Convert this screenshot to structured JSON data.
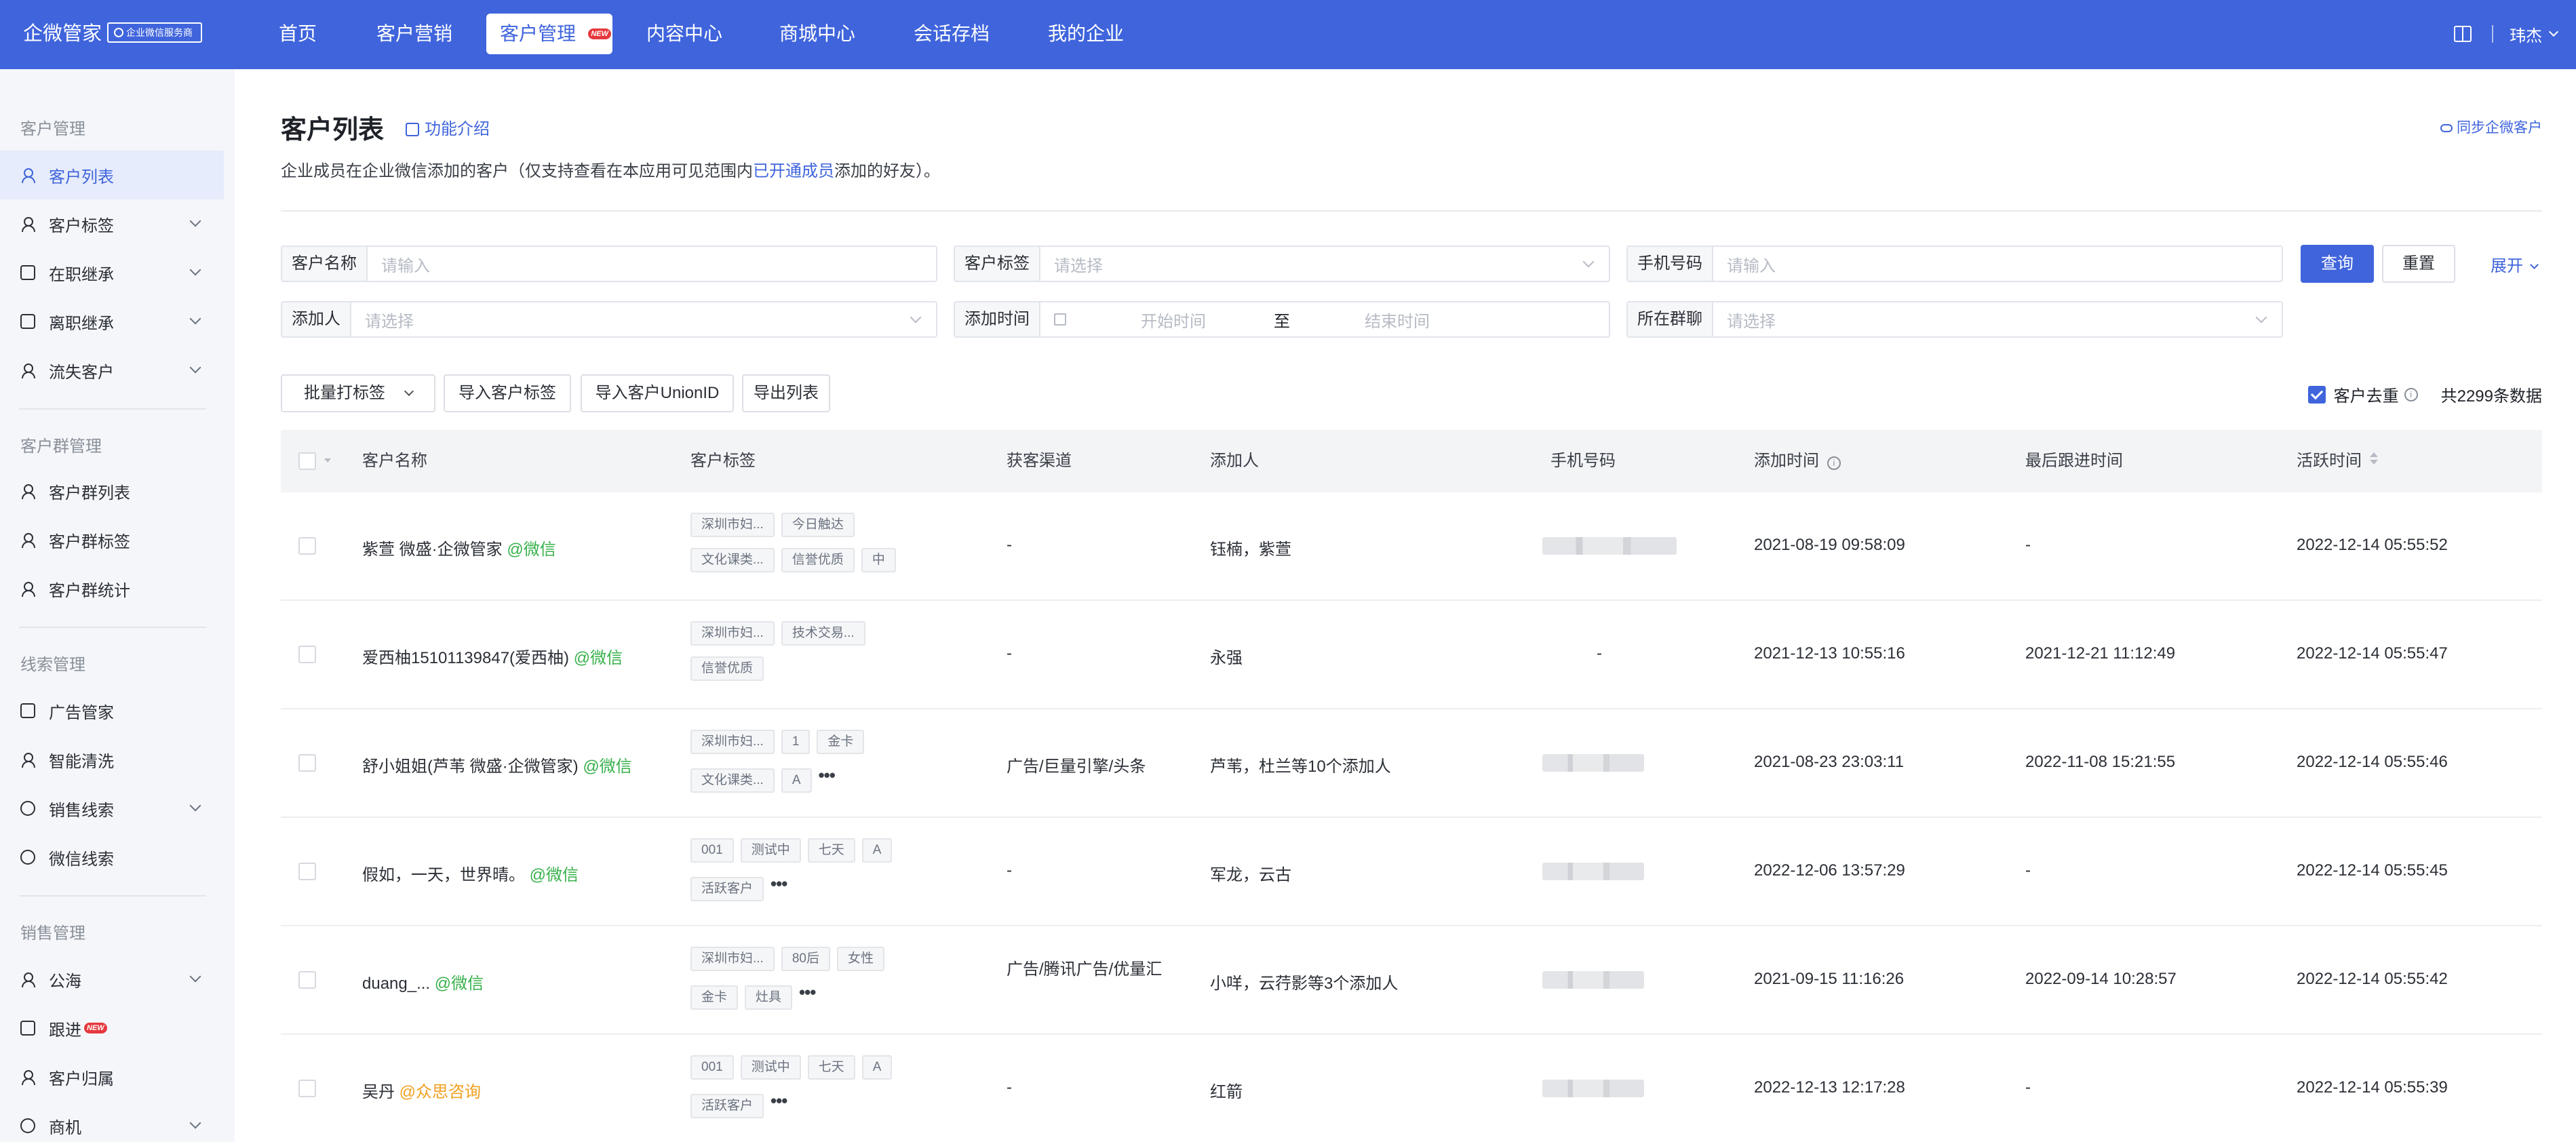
{
  "brand": {
    "name": "企微管家",
    "badge": "企业微信服务商"
  },
  "nav": {
    "items": [
      {
        "label": "首页"
      },
      {
        "label": "客户营销"
      },
      {
        "label": "客户管理",
        "badge": "NEW"
      },
      {
        "label": "内容中心"
      },
      {
        "label": "商城中心"
      },
      {
        "label": "会话存档"
      },
      {
        "label": "我的企业"
      }
    ],
    "user": "玮杰"
  },
  "sidebar": {
    "groups": [
      {
        "title": "客户管理",
        "items": [
          {
            "label": "客户列表",
            "icon": "person-icon"
          },
          {
            "label": "客户标签",
            "icon": "person-icon"
          },
          {
            "label": "在职继承",
            "icon": "transfer-icon"
          },
          {
            "label": "离职继承",
            "icon": "transfer-icon"
          },
          {
            "label": "流失客户",
            "icon": "person-icon"
          }
        ]
      },
      {
        "title": "客户群管理",
        "items": [
          {
            "label": "客户群列表",
            "icon": "group-icon"
          },
          {
            "label": "客户群标签",
            "icon": "group-icon"
          },
          {
            "label": "客户群统计",
            "icon": "group-icon"
          }
        ]
      },
      {
        "title": "线索管理",
        "items": [
          {
            "label": "广告管家",
            "icon": "ad-icon"
          },
          {
            "label": "智能清洗",
            "icon": "person-icon"
          },
          {
            "label": "销售线索",
            "icon": "link-icon"
          },
          {
            "label": "微信线索",
            "icon": "wechat-icon"
          }
        ]
      },
      {
        "title": "销售管理",
        "items": [
          {
            "label": "公海",
            "icon": "person-icon"
          },
          {
            "label": "跟进",
            "icon": "edit-icon",
            "badge": "NEW"
          },
          {
            "label": "客户归属",
            "icon": "person-icon"
          },
          {
            "label": "商机",
            "icon": "target-icon"
          }
        ]
      }
    ]
  },
  "page": {
    "title": "客户列表",
    "intro_link": "功能介绍",
    "sync_link": "同步企微客户",
    "desc_prefix": "企业成员在企业微信添加的客户（仅支持查看在本应用可见范围内",
    "desc_link": "已开通成员",
    "desc_suffix": "添加的好友）。"
  },
  "filters": {
    "customer_name": {
      "label": "客户名称",
      "placeholder": "请输入"
    },
    "customer_tag": {
      "label": "客户标签",
      "placeholder": "请选择"
    },
    "phone": {
      "label": "手机号码",
      "placeholder": "请输入"
    },
    "adder": {
      "label": "添加人",
      "placeholder": "请选择"
    },
    "add_time": {
      "label": "添加时间",
      "start": "开始时间",
      "sep": "至",
      "end": "结束时间"
    },
    "group_chat": {
      "label": "所在群聊",
      "placeholder": "请选择"
    },
    "query": "查询",
    "reset": "重置",
    "expand": "展开"
  },
  "toolbar": {
    "batch_tag": "批量打标签",
    "import_tags": "导入客户标签",
    "import_unionid": "导入客户UnionID",
    "export": "导出列表",
    "dedupe": "客户去重",
    "total": "共2299条数据"
  },
  "table": {
    "columns": [
      "客户名称",
      "客户标签",
      "获客渠道",
      "添加人",
      "手机号码",
      "添加时间",
      "最后跟进时间",
      "活跃时间"
    ],
    "rows": [
      {
        "name": "紫萱 微盛·企微管家",
        "source": "@微信",
        "tags": [
          "深圳市妇...",
          "今日触达",
          "文化课类...",
          "信誉优质",
          "中"
        ],
        "more": false,
        "channel": "-",
        "adder": "钰楠，紫萱",
        "phone_blurred": true,
        "add_time": "2021-08-19 09:58:09",
        "last_follow": "-",
        "active": "2022-12-14 05:55:52"
      },
      {
        "name": "爱西柚15101139847(爱西柚)",
        "source": "@微信",
        "tags": [
          "深圳市妇...",
          "技术交易...",
          "信誉优质"
        ],
        "more": false,
        "channel": "-",
        "adder": "永强",
        "phone_blurred": false,
        "phone": "-",
        "add_time": "2021-12-13 10:55:16",
        "last_follow": "2021-12-21 11:12:49",
        "active": "2022-12-14 05:55:47"
      },
      {
        "name": "舒小姐姐(芦苇 微盛·企微管家)",
        "source": "@微信",
        "tags": [
          "深圳市妇...",
          "1",
          "金卡",
          "文化课类...",
          "A"
        ],
        "more": true,
        "channel": "广告/巨量引擎/头条",
        "adder": "芦苇，杜兰等10个添加人",
        "phone_blurred": true,
        "add_time": "2021-08-23 23:03:11",
        "last_follow": "2022-11-08 15:21:55",
        "active": "2022-12-14 05:55:46"
      },
      {
        "name": "假如，一天，世界晴。",
        "source": "@微信",
        "tags": [
          "001",
          "测试中",
          "七天",
          "A",
          "活跃客户"
        ],
        "more": true,
        "channel": "-",
        "adder": "军龙，云古",
        "phone_blurred": true,
        "add_time": "2022-12-06 13:57:29",
        "last_follow": "-",
        "active": "2022-12-14 05:55:45"
      },
      {
        "name": "duang_...",
        "source": "@微信",
        "tags": [
          "深圳市妇...",
          "80后",
          "女性",
          "金卡",
          "灶具"
        ],
        "more": true,
        "channel": "广告/腾讯广告/优量汇",
        "adder": "小咩，云荇影等3个添加人",
        "phone_blurred": true,
        "add_time": "2021-09-15 11:16:26",
        "last_follow": "2022-09-14 10:28:57",
        "active": "2022-12-14 05:55:42"
      },
      {
        "name": "吴丹",
        "source": "@众思咨询",
        "tags": [
          "001",
          "测试中",
          "七天",
          "A",
          "活跃客户"
        ],
        "more": true,
        "channel": "-",
        "adder": "红箭",
        "phone_blurred": true,
        "add_time": "2022-12-13 12:17:28",
        "last_follow": "-",
        "active": "2022-12-14 05:55:39"
      }
    ]
  },
  "colors": {
    "primary": "#3f64dc",
    "wechat": "#37b04a",
    "corp": "#f0a020",
    "danger": "#e6383d"
  }
}
